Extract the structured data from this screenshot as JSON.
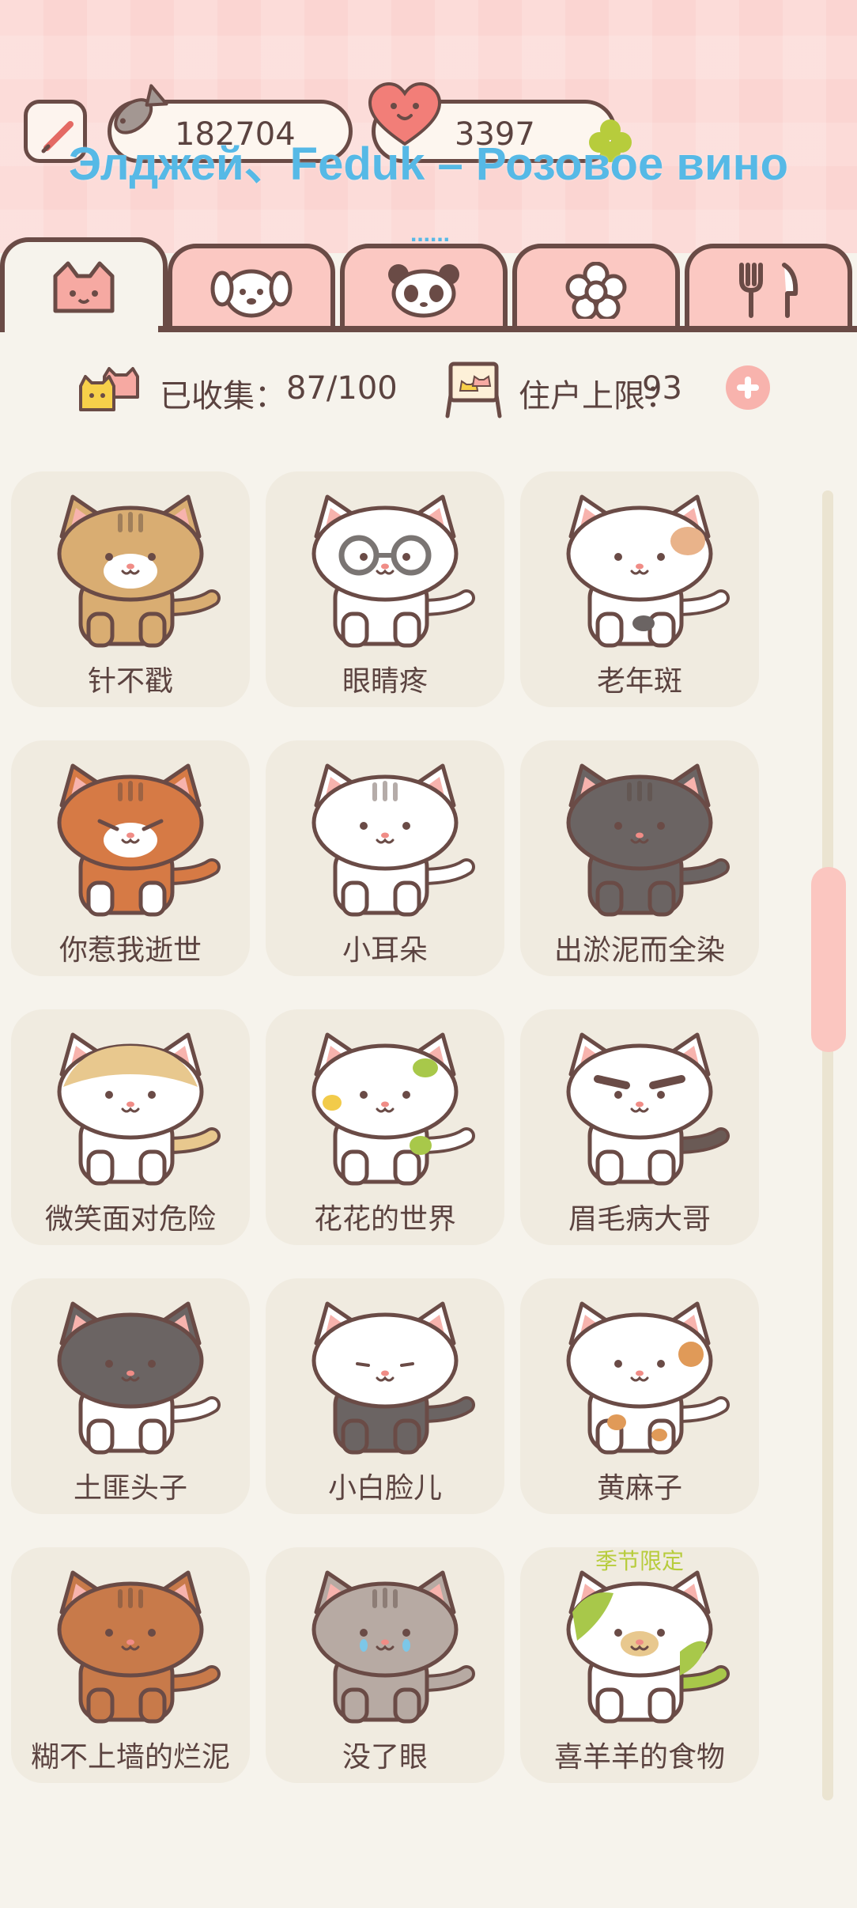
{
  "header": {
    "fish_count": "182704",
    "heart_count": "3397",
    "overlay_lyric": "Элджей、Feduk – Розовое вино",
    "overlay_dots": "......"
  },
  "tabs": [
    {
      "icon": "cat-tab-icon",
      "active": true
    },
    {
      "icon": "dog-tab-icon",
      "active": false
    },
    {
      "icon": "panda-tab-icon",
      "active": false
    },
    {
      "icon": "flower-tab-icon",
      "active": false
    },
    {
      "icon": "utensils-tab-icon",
      "active": false
    }
  ],
  "stats": {
    "collected_label": "已收集：",
    "collected_value": "87/100",
    "capacity_label": "住户上限：",
    "capacity_value": "93"
  },
  "cats": [
    {
      "name": "针不戳",
      "body": "#d9ad72",
      "face": "#d9ad72",
      "legs": "#d9ad72",
      "tail": "#d9ad72",
      "style": "tabby-lynx"
    },
    {
      "name": "眼睛疼",
      "body": "#ffffff",
      "face": "#ffffff",
      "legs": "#ffffff",
      "tail": "#ffffff",
      "style": "glasses"
    },
    {
      "name": "老年斑",
      "body": "#ffffff",
      "face": "#ffffff",
      "legs": "#ffffff",
      "tail": "#ffffff",
      "style": "spots"
    },
    {
      "name": "你惹我逝世",
      "body": "#d67a45",
      "face": "#d67a45",
      "legs": "#ffffff",
      "tail": "#d67a45",
      "style": "angry"
    },
    {
      "name": "小耳朵",
      "body": "#ffffff",
      "face": "#ffffff",
      "legs": "#ffffff",
      "tail": "#ffffff",
      "style": "stripes"
    },
    {
      "name": "出淤泥而全染",
      "body": "#6b6463",
      "face": "#6b6463",
      "legs": "#6b6463",
      "tail": "#6b6463",
      "style": "grey"
    },
    {
      "name": "微笑面对危险",
      "body": "#ffffff",
      "face": "#ffffff",
      "legs": "#ffffff",
      "tail": "#e8c88e",
      "style": "tan-cap"
    },
    {
      "name": "花花的世界",
      "body": "#ffffff",
      "face": "#ffffff",
      "legs": "#ffffff",
      "tail": "#ffffff",
      "style": "flower"
    },
    {
      "name": "眉毛病大哥",
      "body": "#ffffff",
      "face": "#ffffff",
      "legs": "#ffffff",
      "tail": "#6a5a55",
      "style": "brows"
    },
    {
      "name": "土匪头子",
      "body": "#ffffff",
      "face": "#6b6463",
      "legs": "#ffffff",
      "tail": "#ffffff",
      "style": "bandit"
    },
    {
      "name": "小白脸儿",
      "body": "#6b6463",
      "face": "#ffffff",
      "legs": "#6b6463",
      "tail": "#6b6463",
      "style": "whiteface"
    },
    {
      "name": "黄麻子",
      "body": "#ffffff",
      "face": "#ffffff",
      "legs": "#ffffff",
      "tail": "#ffffff",
      "style": "freckles"
    },
    {
      "name": "糊不上墙的烂泥",
      "body": "#c87a4a",
      "face": "#c87a4a",
      "legs": "#c87a4a",
      "tail": "#c87a4a",
      "style": "mud"
    },
    {
      "name": "没了眼",
      "body": "#b7aaa3",
      "face": "#b7aaa3",
      "legs": "#b7aaa3",
      "tail": "#b7aaa3",
      "style": "tears"
    },
    {
      "name": "喜羊羊的食物",
      "body": "#ffffff",
      "face": "#ffffff",
      "legs": "#ffffff",
      "tail": "#a8c84a",
      "style": "grass",
      "tag": "季节限定"
    }
  ]
}
